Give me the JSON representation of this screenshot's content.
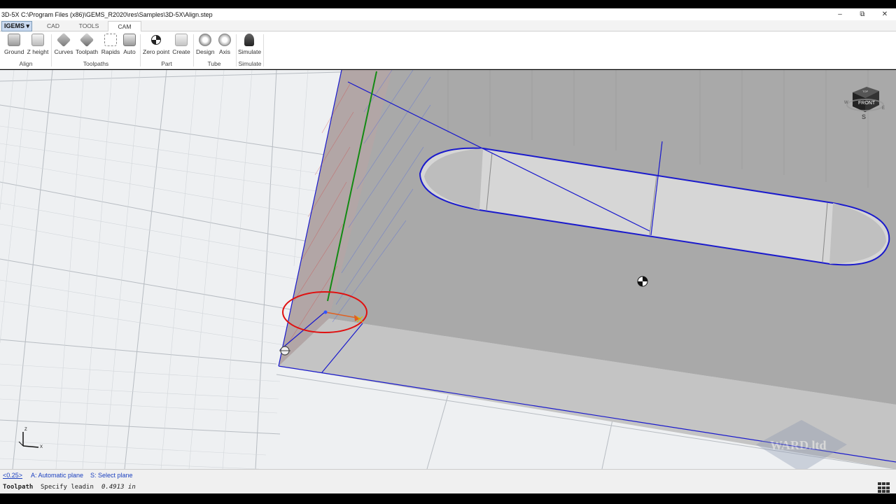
{
  "window": {
    "title": "3D-5X C:\\Program Files (x86)\\GEMS_R2020\\res\\Samples\\3D-5X\\Align.step",
    "minimize": "–",
    "restore": "⧉",
    "close": "✕"
  },
  "tabs": {
    "igems": "IGEMS",
    "igems_arrow": "▾",
    "cad": "CAD",
    "tools": "TOOLS",
    "cam": "CAM"
  },
  "ribbon": {
    "ground": "Ground",
    "z_height": "Z height",
    "curves": "Curves",
    "toolpath": "Toolpath",
    "rapids": "Rapids",
    "auto": "Auto",
    "zero_point": "Zero point",
    "create": "Create",
    "design": "Design",
    "axis": "Axis",
    "simulate": "Simulate",
    "group_align": "Align",
    "group_toolpaths": "Toolpaths",
    "group_part": "Part",
    "group_tube": "Tube",
    "group_simulate": "Simulate"
  },
  "viewcube": {
    "face": "FRONT",
    "compass": "S",
    "top": "TOP",
    "left_label": "W",
    "right_label": "E"
  },
  "axes": {
    "z": "Z",
    "x": "X"
  },
  "watermark": "WARD.ltd",
  "cmdbar": {
    "value": "<0.25>",
    "option_a": "A: Automatic plane",
    "option_s": "S: Select plane"
  },
  "status": {
    "mode": "Toolpath",
    "prompt": "Specify leadin",
    "value": "0.4913 in"
  },
  "colors": {
    "part_top": "#a9a9a9",
    "part_front": "#c4c4c4",
    "edge_blue": "#1a1acc",
    "highlight_red": "#e01010",
    "axis_green": "#138a13"
  }
}
